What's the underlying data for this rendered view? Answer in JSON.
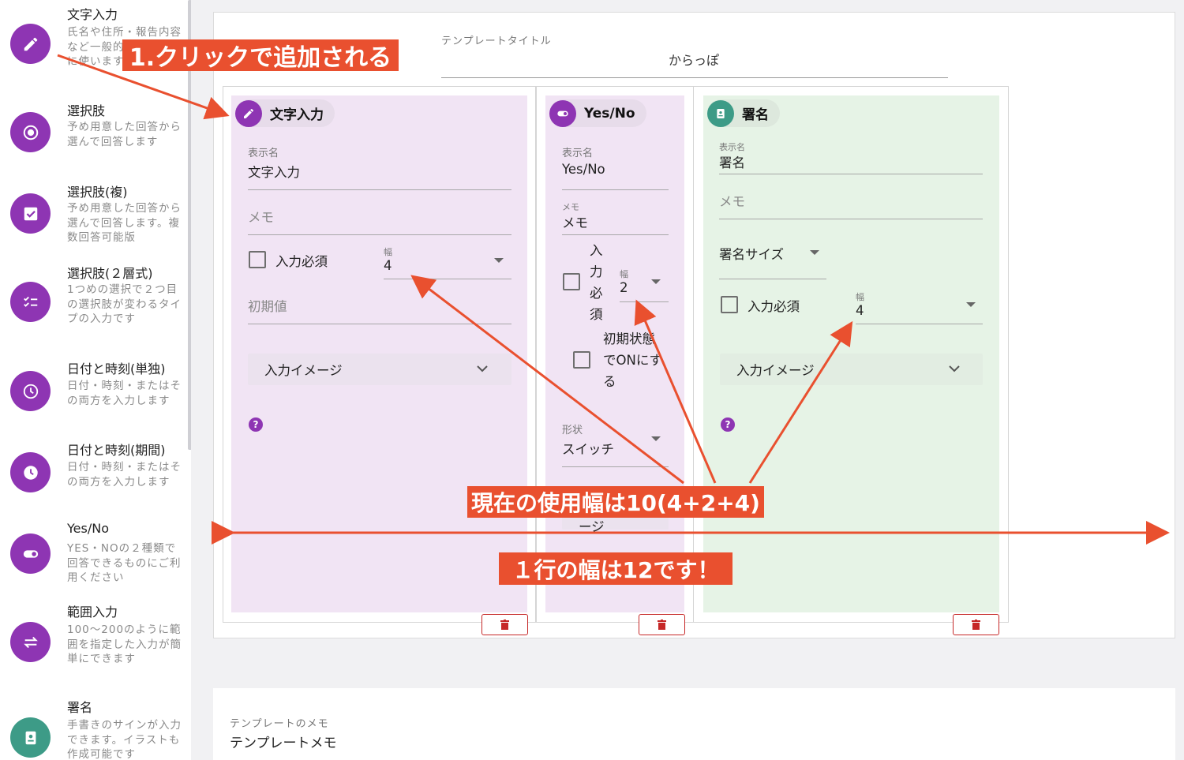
{
  "sidebar": {
    "items": [
      {
        "title": "文字入力",
        "desc": "氏名や住所・報告内容など一般的な文字入力に使います",
        "icon": "pencil-icon"
      },
      {
        "title": "選択肢",
        "desc": "予め用意した回答から選んで回答します",
        "icon": "radio-icon"
      },
      {
        "title": "選択肢(複)",
        "desc": "予め用意した回答から選んで回答します。複数回答可能版",
        "icon": "checkbox-icon"
      },
      {
        "title": "選択肢(２層式)",
        "desc": "1つめの選択で２つ目の選択肢が変わるタイプの入力です",
        "icon": "checklist-icon"
      },
      {
        "title": "日付と時刻(単独)",
        "desc": "日付・時刻・またはその両方を入力します",
        "icon": "clock-outline-icon"
      },
      {
        "title": "日付と時刻(期間)",
        "desc": "日付・時刻・またはその両方を入力します",
        "icon": "clock-filled-icon"
      },
      {
        "title": "Yes/No",
        "desc": "YES・NOの２種類で回答できるものにご利用ください",
        "icon": "toggle-icon"
      },
      {
        "title": "範囲入力",
        "desc": "100〜200のように範囲を指定した入力が簡単にできます",
        "icon": "swap-icon"
      },
      {
        "title": "署名",
        "desc": "手書きのサインが入力できます。イラストも作成可能です",
        "icon": "signature-icon"
      }
    ]
  },
  "template": {
    "title_label": "テンプレートタイトル",
    "title_value": "からっぽ",
    "memo_label": "テンプレートのメモ",
    "memo_value": "テンプレートメモ"
  },
  "columns": {
    "text": {
      "chip": "文字入力",
      "display_label": "表示名",
      "display_value": "文字入力",
      "memo_placeholder": "メモ",
      "required_label": "入力必須",
      "width_label": "幅",
      "width_value": "4",
      "default_placeholder": "初期値",
      "image_label": "入力イメージ",
      "help": "?"
    },
    "yesno": {
      "chip": "Yes/No",
      "display_label": "表示名",
      "display_value": "Yes/No",
      "memo_label": "メモ",
      "memo_value": "メモ",
      "required_chars": [
        "入",
        "力",
        "必",
        "須"
      ],
      "width_label": "幅",
      "width_value": "2",
      "initial_lines": [
        "初期状態",
        "でONにす",
        "る"
      ],
      "shape_label": "形状",
      "shape_value": "スイッチ",
      "image_partial": "ージ"
    },
    "signature": {
      "chip": "署名",
      "display_label": "表示名",
      "display_value": "署名",
      "memo_placeholder": "メモ",
      "size_label": "署名サイズ",
      "required_label": "入力必須",
      "width_label": "幅",
      "width_value": "4",
      "image_label": "入力イメージ",
      "help": "?"
    }
  },
  "annotations": {
    "click_add": "1.クリックで追加される",
    "used_width": "現在の使用幅は10(4+2+4)",
    "row_width": "１行の幅は12です！"
  },
  "colors": {
    "purple": "#8e35b3",
    "green": "#3d9b87",
    "annotation": "#e9502f",
    "delete": "#c62828"
  }
}
